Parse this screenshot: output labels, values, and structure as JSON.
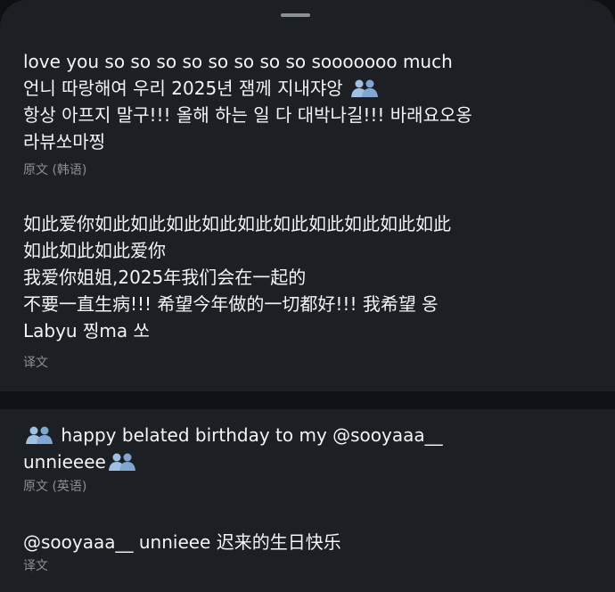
{
  "original_block": {
    "lines": [
      "love you so so so so so so so so sooooooo much",
      "언니 따랑해여 우리 2025년 잼께 지내쟈앙",
      "항상 아프지 말구!!! 올해 하는 일 다 대박나길!!! 바래요오옹",
      "라뷰쏘마찡"
    ],
    "label": "原文 (韩语)"
  },
  "translation_block": {
    "lines": [
      "如此爱你如此如此如此如此如此如此如此如此如此如此",
      "如此如此如此爱你",
      "我爱你姐姐,2025年我们会在一起的",
      "不要一直生病!!! 希望今年做的一切都好!!! 我希望 옹",
      "Labyu 찡ma 쏘"
    ],
    "label": "译文"
  },
  "second_original": {
    "line1": "happy belated birthday to my @sooyaaa__",
    "line2": "unnieeee",
    "label": "原文 (英语)"
  },
  "second_translation": {
    "line": "@sooyaaa__ unnieee 迟来的生日快乐",
    "label": "译文"
  },
  "emoji": {
    "name": "people-silhouette-emoji",
    "color": "#8fb4d9"
  },
  "colors": {
    "background": "#1c1f24",
    "divider": "#101215",
    "text": "#f4f4f4",
    "muted": "#8c9096"
  }
}
